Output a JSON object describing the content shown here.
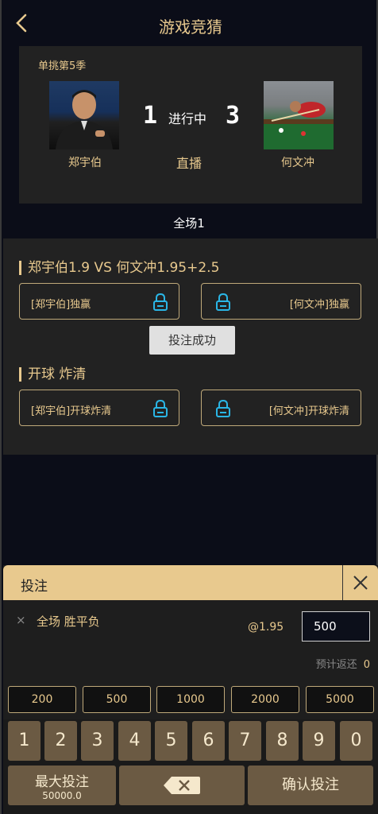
{
  "header": {
    "title": "游戏竞猜",
    "back_icon": "chevron-left-icon"
  },
  "match": {
    "season": "单挑第5季",
    "player1": {
      "name": "郑宇伯",
      "score": "1"
    },
    "player2": {
      "name": "何文冲",
      "score": "3"
    },
    "status": "进行中",
    "live": "直播",
    "period": "全场1"
  },
  "markets": [
    {
      "title": "郑宇伯1.9 VS 何文冲1.95+2.5",
      "options": [
        {
          "label": "[郑宇伯]独赢"
        },
        {
          "label": "[何文冲]独赢"
        }
      ]
    },
    {
      "title": "开球 炸清",
      "options": [
        {
          "label": "[郑宇伯]开球炸清"
        },
        {
          "label": "[何文冲]开球炸清"
        }
      ]
    }
  ],
  "toast": "投注成功",
  "bet_panel": {
    "title": "投注",
    "bet_name": "全场 胜平负",
    "odds": "@1.95",
    "amount": "500",
    "return_label": "预计返还",
    "return_value": "0",
    "remove_icon": "×"
  },
  "chips": [
    "200",
    "500",
    "1000",
    "2000",
    "5000"
  ],
  "keypad": {
    "digits": [
      "1",
      "2",
      "3",
      "4",
      "5",
      "6",
      "7",
      "8",
      "9",
      "0"
    ],
    "max_label": "最大投注",
    "max_value": "50000.0",
    "confirm": "确认投注"
  },
  "colors": {
    "accent": "#e8c98e",
    "lock": "#2ab6e6",
    "panel": "#222222",
    "background": "#0b0d18"
  }
}
